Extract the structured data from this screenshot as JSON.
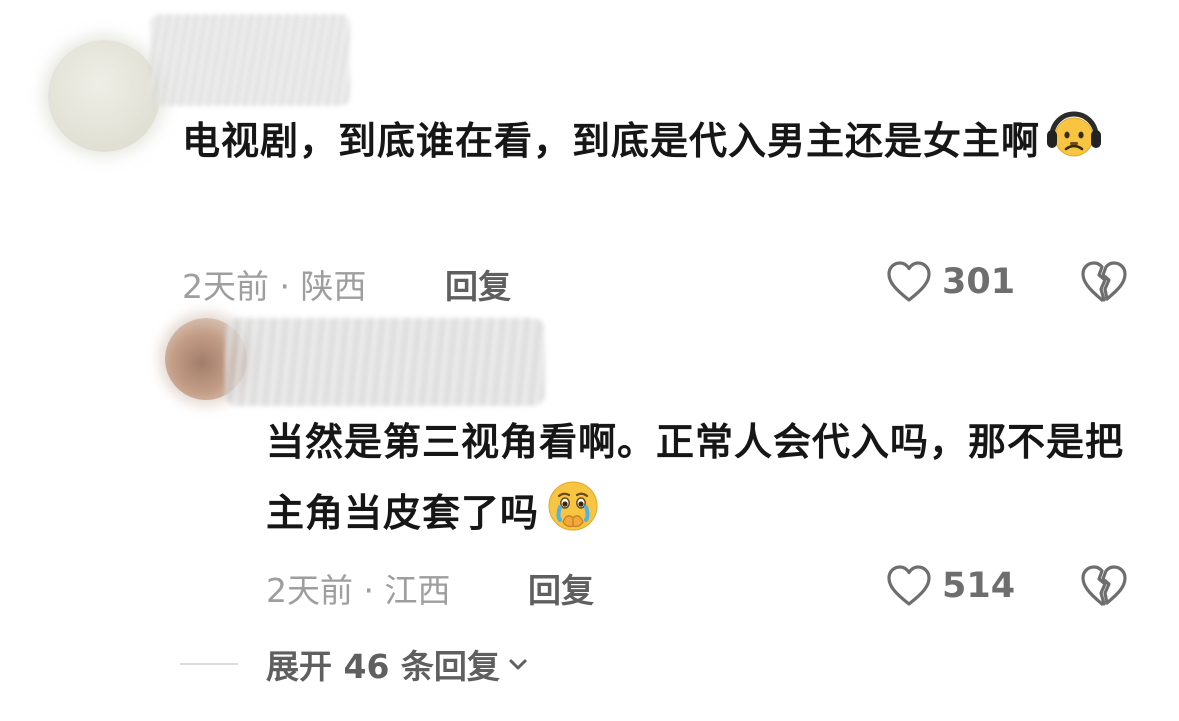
{
  "comments": [
    {
      "text": "电视剧，到底谁在看，到底是代入男主还是女主啊",
      "emoji": "headphones-frown-face-emoji",
      "time": "2天前",
      "separator": "·",
      "location": "陕西",
      "reply_label": "回复",
      "likes": "301"
    },
    {
      "text": "当然是第三视角看啊。正常人会代入吗，那不是把主角当皮套了吗",
      "emoji": "crying-face-covering-mouth-emoji",
      "time": "2天前",
      "separator": "·",
      "location": "江西",
      "reply_label": "回复",
      "likes": "514"
    }
  ],
  "expand": {
    "label": "展开 46 条回复"
  },
  "icons": {
    "like": "heart-outline-icon",
    "dislike": "broken-heart-icon",
    "expand": "chevron-down-icon"
  },
  "colors": {
    "text": "#161616",
    "meta": "#9e9e9e",
    "action": "#5f5f5f",
    "icon": "#6e6e6e"
  }
}
